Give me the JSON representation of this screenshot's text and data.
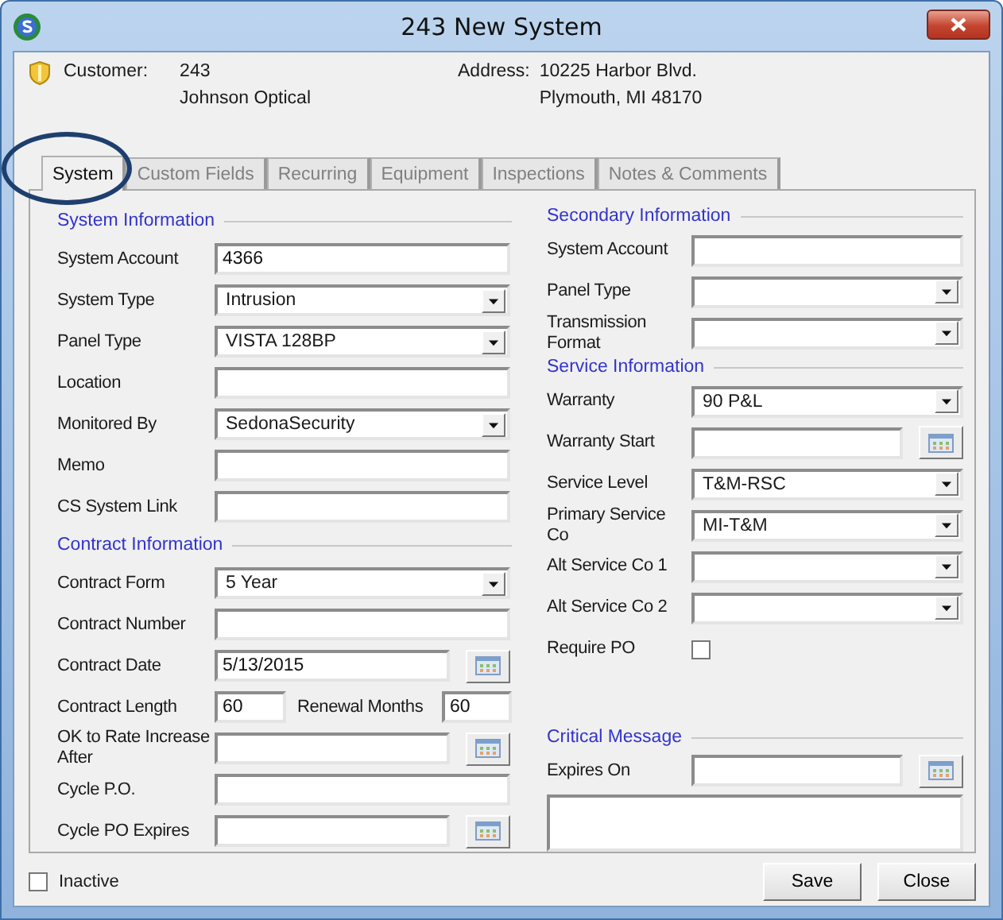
{
  "window": {
    "title": "243 New System"
  },
  "customer": {
    "label": "Customer:",
    "number": "243",
    "name": "Johnson Optical"
  },
  "address": {
    "label": "Address:",
    "line1": "10225 Harbor Blvd.",
    "line2": "Plymouth, MI  48170"
  },
  "tabs": [
    {
      "label": "System",
      "selected": true
    },
    {
      "label": "Custom Fields",
      "selected": false
    },
    {
      "label": "Recurring",
      "selected": false
    },
    {
      "label": "Equipment",
      "selected": false
    },
    {
      "label": "Inspections",
      "selected": false
    },
    {
      "label": "Notes & Comments",
      "selected": false
    }
  ],
  "left_sections": [
    {
      "title": "System Information",
      "rows": [
        {
          "kind": "text",
          "label": "System Account",
          "value": "4366"
        },
        {
          "kind": "select",
          "label": "System Type",
          "value": "Intrusion"
        },
        {
          "kind": "select",
          "label": "Panel Type",
          "value": "VISTA 128BP"
        },
        {
          "kind": "text",
          "label": "Location"
        },
        {
          "kind": "select",
          "label": "Monitored By",
          "value": "SedonaSecurity"
        },
        {
          "kind": "text",
          "label": "Memo"
        },
        {
          "kind": "text",
          "label": "CS System Link"
        }
      ]
    },
    {
      "title": "Contract Information",
      "rows": [
        {
          "kind": "select",
          "label": "Contract Form",
          "value": "5 Year"
        },
        {
          "kind": "text",
          "label": "Contract Number"
        },
        {
          "kind": "date",
          "label": "Contract Date",
          "value": "5/13/2015"
        },
        {
          "kind": "pair",
          "label": "Contract Length",
          "value": "60",
          "second_label": "Renewal Months",
          "second_value": "60"
        },
        {
          "kind": "date",
          "label": "OK to Rate Increase After"
        },
        {
          "kind": "text",
          "label": "Cycle P.O."
        },
        {
          "kind": "date",
          "label": "Cycle PO Expires"
        }
      ]
    }
  ],
  "right_sections": [
    {
      "title": "Secondary Information",
      "rows": [
        {
          "kind": "text",
          "label": "System Account"
        },
        {
          "kind": "select",
          "label": "Panel Type"
        },
        {
          "kind": "select",
          "label": "Transmission Format"
        }
      ]
    },
    {
      "title": "Service Information",
      "rows": [
        {
          "kind": "select",
          "label": "Warranty",
          "value": "90 P&L"
        },
        {
          "kind": "date",
          "label": "Warranty Start"
        },
        {
          "kind": "select",
          "label": "Service Level",
          "value": "T&M-RSC"
        },
        {
          "kind": "select",
          "label": "Primary Service Co",
          "value": "MI-T&M"
        },
        {
          "kind": "select",
          "label": "Alt Service Co 1"
        },
        {
          "kind": "select",
          "label": "Alt Service Co 2"
        },
        {
          "kind": "checkbox",
          "label": "Require PO",
          "checked": false
        }
      ]
    },
    {
      "title": "Critical Message",
      "rows": [
        {
          "kind": "date",
          "label": "Expires On"
        },
        {
          "kind": "memo"
        }
      ]
    }
  ],
  "inactive": {
    "label": "Inactive",
    "checked": false
  },
  "buttons": [
    "Save",
    "Close"
  ]
}
